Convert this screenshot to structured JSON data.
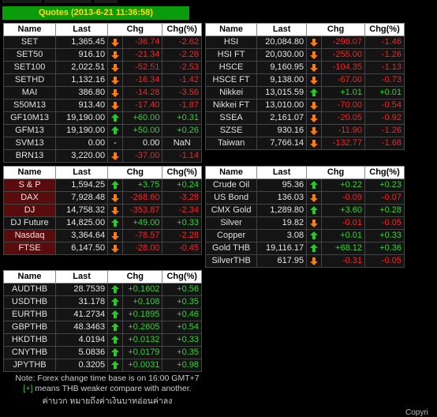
{
  "title": "Quotes (2013-6-21 11:36:58)",
  "headers": [
    "Name",
    "Last",
    "Chg",
    "Chg(%)"
  ],
  "thai_indices": [
    {
      "name": "SET",
      "last": "1,365.45",
      "dir": "down",
      "chg": "-36.74",
      "pct": "-2.62"
    },
    {
      "name": "SET50",
      "last": "916.10",
      "dir": "down",
      "chg": "-21.34",
      "pct": "-2.28"
    },
    {
      "name": "SET100",
      "last": "2,022.51",
      "dir": "down",
      "chg": "-52.51",
      "pct": "-2.53"
    },
    {
      "name": "SETHD",
      "last": "1,132.16",
      "dir": "down",
      "chg": "-16.34",
      "pct": "-1.42"
    },
    {
      "name": "MAI",
      "last": "386.80",
      "dir": "down",
      "chg": "-14.28",
      "pct": "-3.56"
    },
    {
      "name": "S50M13",
      "last": "913.40",
      "dir": "down",
      "chg": "-17.40",
      "pct": "-1.87"
    },
    {
      "name": "GF10M13",
      "last": "19,190.00",
      "dir": "up",
      "chg": "+60.00",
      "pct": "+0.31"
    },
    {
      "name": "GFM13",
      "last": "19,190.00",
      "dir": "up",
      "chg": "+50.00",
      "pct": "+0.26"
    },
    {
      "name": "SVM13",
      "last": "0.00",
      "dir": "none",
      "sym": "-",
      "chg": "0.00",
      "pct": "NaN"
    },
    {
      "name": "BRN13",
      "last": "3,220.00",
      "dir": "down",
      "chg": "-37.00",
      "pct": "-1.14"
    }
  ],
  "asia_indices": [
    {
      "name": "HSI",
      "last": "20,084.80",
      "dir": "down",
      "chg": "-298.07",
      "pct": "-1.46"
    },
    {
      "name": "HSI FT",
      "last": "20,030.00",
      "dir": "down",
      "chg": "-255.00",
      "pct": "-1.26"
    },
    {
      "name": "HSCE",
      "last": "9,160.95",
      "dir": "down",
      "chg": "-104.35",
      "pct": "-1.13"
    },
    {
      "name": "HSCE FT",
      "last": "9,138.00",
      "dir": "down",
      "chg": "-67.00",
      "pct": "-0.73"
    },
    {
      "name": "Nikkei",
      "last": "13,015.59",
      "dir": "up",
      "chg": "+1.01",
      "pct": "+0.01"
    },
    {
      "name": "Nikkei FT",
      "last": "13,010.00",
      "dir": "down",
      "chg": "-70.00",
      "pct": "-0.54"
    },
    {
      "name": "SSEA",
      "last": "2,161.07",
      "dir": "down",
      "chg": "-20.05",
      "pct": "-0.92"
    },
    {
      "name": "SZSE",
      "last": "930.16",
      "dir": "down",
      "chg": "-11.90",
      "pct": "-1.26"
    },
    {
      "name": "Taiwan",
      "last": "7,766.14",
      "dir": "down",
      "chg": "-132.77",
      "pct": "-1.68"
    }
  ],
  "us_eu_indices": [
    {
      "name": "S & P",
      "last": "1,594.25",
      "dir": "up",
      "chg": "+3.75",
      "pct": "+0.24",
      "red": true
    },
    {
      "name": "DAX",
      "last": "7,928.48",
      "dir": "down",
      "chg": "-268.60",
      "pct": "-3.28",
      "red": true
    },
    {
      "name": "DJ",
      "last": "14,758.32",
      "dir": "down",
      "chg": "-353.87",
      "pct": "-2.34",
      "red": true
    },
    {
      "name": "DJ Future",
      "last": "14,825.00",
      "dir": "up",
      "chg": "+49.00",
      "pct": "+0.33",
      "red": false
    },
    {
      "name": "Nasdaq",
      "last": "3,364.64",
      "dir": "down",
      "chg": "-78.57",
      "pct": "-2.28",
      "red": true
    },
    {
      "name": "FTSE",
      "last": "6,147.50",
      "dir": "down",
      "chg": "-28.00",
      "pct": "-0.45",
      "red": true
    }
  ],
  "commodities": [
    {
      "name": "Crude Oil",
      "last": "95.36",
      "dir": "up",
      "chg": "+0.22",
      "pct": "+0.23"
    },
    {
      "name": "US Bond",
      "last": "136.03",
      "dir": "down",
      "chg": "-0.09",
      "pct": "-0.07"
    },
    {
      "name": "CMX Gold",
      "last": "1,289.80",
      "dir": "up",
      "chg": "+3.60",
      "pct": "+0.28"
    },
    {
      "name": "Silver",
      "last": "19.82",
      "dir": "down",
      "chg": "-0.01",
      "pct": "-0.05"
    },
    {
      "name": "Copper",
      "last": "3.08",
      "dir": "up",
      "chg": "+0.01",
      "pct": "+0.33"
    },
    {
      "name": "Gold THB",
      "last": "19,116.17",
      "dir": "up",
      "chg": "+68.12",
      "pct": "+0.36"
    },
    {
      "name": "SilverTHB",
      "last": "617.95",
      "dir": "down",
      "chg": "-0.31",
      "pct": "-0.05"
    }
  ],
  "forex": [
    {
      "name": "AUDTHB",
      "last": "28.7539",
      "dir": "up",
      "chg": "+0.1602",
      "pct": "+0.56"
    },
    {
      "name": "USDTHB",
      "last": "31.178",
      "dir": "up",
      "chg": "+0.108",
      "pct": "+0.35"
    },
    {
      "name": "EURTHB",
      "last": "41.2734",
      "dir": "up",
      "chg": "+0.1895",
      "pct": "+0.46"
    },
    {
      "name": "GBPTHB",
      "last": "48.3463",
      "dir": "up",
      "chg": "+0.2605",
      "pct": "+0.54"
    },
    {
      "name": "HKDTHB",
      "last": "4.0194",
      "dir": "up",
      "chg": "+0.0132",
      "pct": "+0.33"
    },
    {
      "name": "CNYTHB",
      "last": "5.0836",
      "dir": "up",
      "chg": "+0.0179",
      "pct": "+0.35"
    },
    {
      "name": "JPYTHB",
      "last": "0.3205",
      "dir": "up",
      "chg": "+0.0031",
      "pct": "+0.98"
    }
  ],
  "notes": {
    "line1": "Note: Forex change time base is on 16:00 GMT+7",
    "line2_plus": "[+]",
    "line2_rest": " means THB weaker compare with another.",
    "line3": "ค่าบวก หมายถึงค่าเงินบาทอ่อนค่าลง"
  },
  "corner_text": "Copyri",
  "colors": {
    "up": "#2fd52f",
    "down": "#ff2020",
    "title_bg": "#0a9c0a",
    "title_fg": "#ffe000",
    "arrow_up": "#22cc22",
    "arrow_down": "#ff7a10"
  }
}
